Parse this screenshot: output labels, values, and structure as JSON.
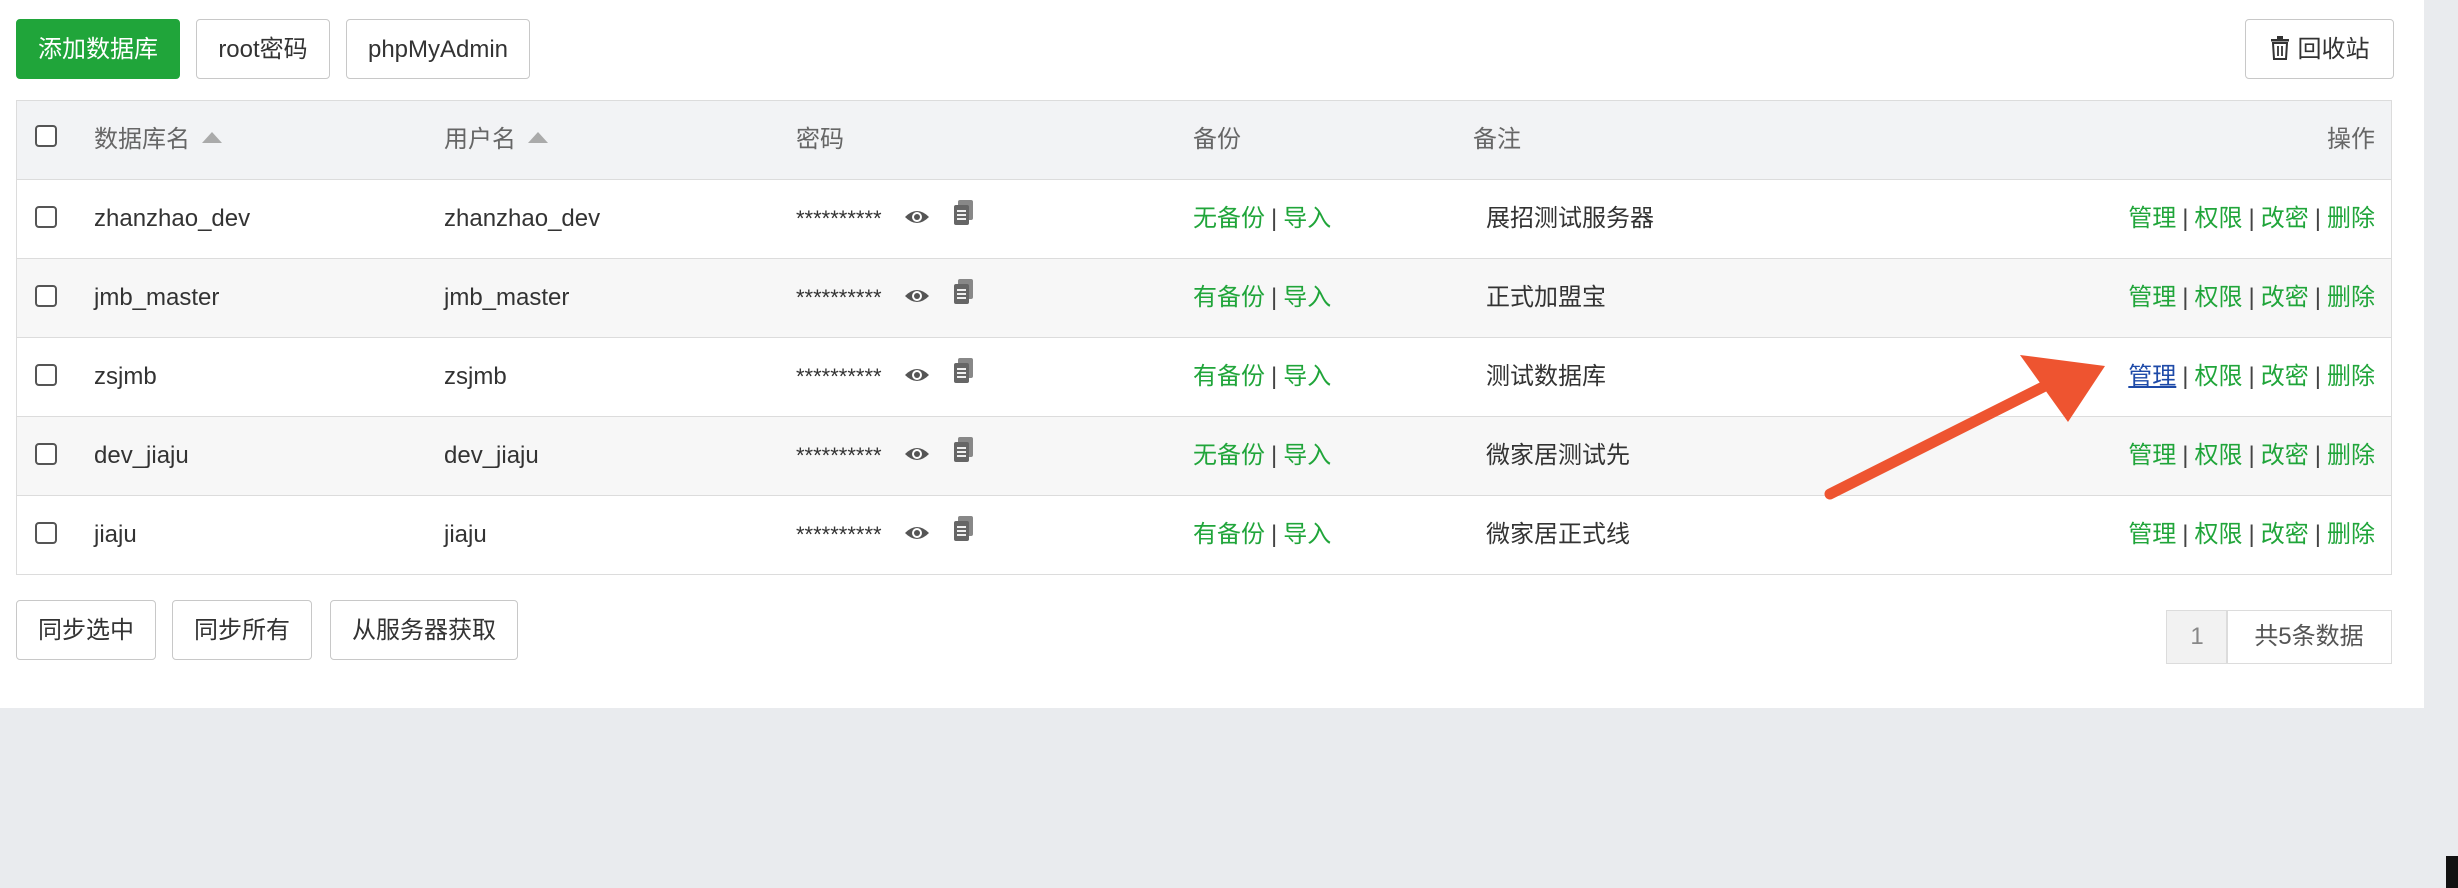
{
  "toolbar": {
    "add_db": "添加数据库",
    "root_pwd": "root密码",
    "phpmyadmin": "phpMyAdmin",
    "recycle": "回收站"
  },
  "table": {
    "headers": {
      "name": "数据库名",
      "user": "用户名",
      "password": "密码",
      "backup": "备份",
      "remark": "备注",
      "actions": "操作"
    },
    "rows": [
      {
        "name": "zhanzhao_dev",
        "user": "zhanzhao_dev",
        "password": "**********",
        "backup": "无备份",
        "import": "导入",
        "remark": "展招测试服务器"
      },
      {
        "name": "jmb_master",
        "user": "jmb_master",
        "password": "**********",
        "backup": "有备份",
        "import": "导入",
        "remark": "正式加盟宝"
      },
      {
        "name": "zsjmb",
        "user": "zsjmb",
        "password": "**********",
        "backup": "有备份",
        "import": "导入",
        "remark": "测试数据库"
      },
      {
        "name": "dev_jiaju",
        "user": "dev_jiaju",
        "password": "**********",
        "backup": "无备份",
        "import": "导入",
        "remark": "微家居测试先"
      },
      {
        "name": "jiaju",
        "user": "jiaju",
        "password": "**********",
        "backup": "有备份",
        "import": "导入",
        "remark": "微家居正式线"
      }
    ],
    "actions": {
      "manage": "管理",
      "permission": "权限",
      "change_pwd": "改密",
      "delete": "删除",
      "separator": "|"
    }
  },
  "footer": {
    "sync_selected": "同步选中",
    "sync_all": "同步所有",
    "fetch_server": "从服务器获取",
    "page": "1",
    "total": "共5条数据"
  },
  "colors": {
    "accent": "#20a53a",
    "arrow": "#ee5430",
    "active_link": "#1e4aa8"
  },
  "icons": [
    "trash-icon",
    "eye-icon",
    "copy-icon",
    "sort-up-icon",
    "arrow-annotation"
  ]
}
